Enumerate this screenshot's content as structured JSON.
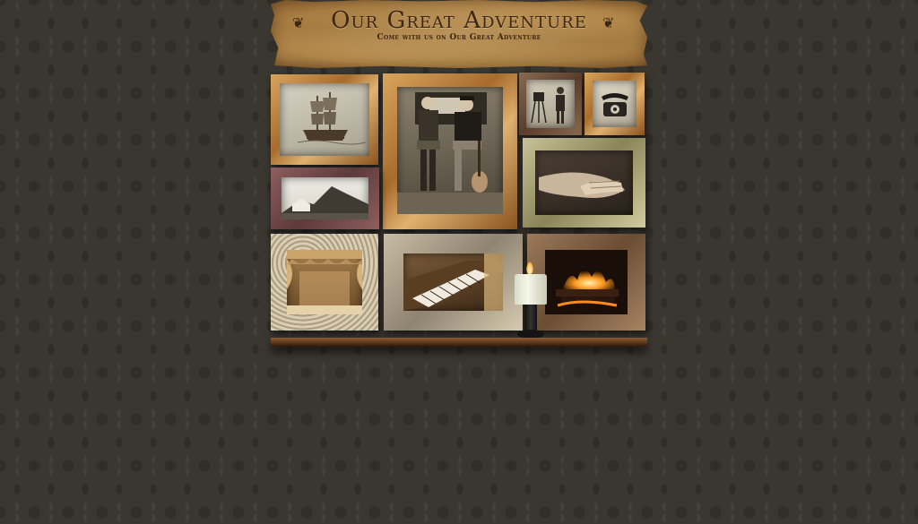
{
  "banner": {
    "title": "Our Great Adventure",
    "subtitle": "Come with us on Our Great Adventure",
    "flourish_left": "❦",
    "flourish_right": "❦"
  },
  "frames": [
    {
      "id": "ship",
      "icon": "ship-icon",
      "subject": "sailing ship drawing"
    },
    {
      "id": "band",
      "icon": "band-photo-icon",
      "subject": "two musicians seated with guitar"
    },
    {
      "id": "camera",
      "icon": "camera-icon",
      "subject": "man with vintage camera"
    },
    {
      "id": "telephone",
      "icon": "telephone-icon",
      "subject": "antique telephone"
    },
    {
      "id": "mountain",
      "icon": "mountain-icon",
      "subject": "mountain landscape"
    },
    {
      "id": "hands",
      "icon": "hands-icon",
      "subject": "clasped hands"
    },
    {
      "id": "stage",
      "icon": "stage-icon",
      "subject": "theatre stage curtains"
    },
    {
      "id": "piano",
      "icon": "piano-icon",
      "subject": "piano keyboard"
    },
    {
      "id": "fireplace",
      "icon": "fireplace-icon",
      "subject": "fireplace flames"
    }
  ],
  "colors": {
    "background": "#3a3731",
    "parchment": "#c9a064",
    "banner_text": "#3b2612",
    "shelf": "#5a3418"
  }
}
